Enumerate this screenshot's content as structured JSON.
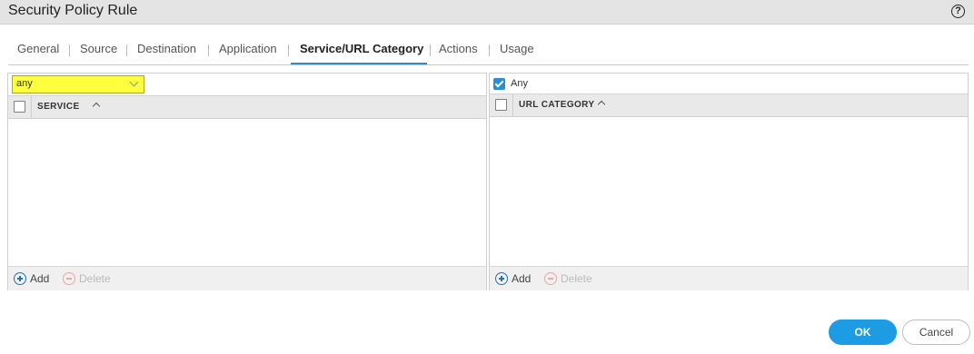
{
  "dialog": {
    "title": "Security Policy Rule",
    "help_icon": "?"
  },
  "tabs": [
    {
      "label": "General"
    },
    {
      "label": "Source"
    },
    {
      "label": "Destination"
    },
    {
      "label": "Application"
    },
    {
      "label": "Service/URL Category",
      "active": true
    },
    {
      "label": "Actions"
    },
    {
      "label": "Usage"
    }
  ],
  "service_panel": {
    "dropdown_value": "any",
    "column_header": "SERVICE",
    "add_label": "Add",
    "delete_label": "Delete"
  },
  "url_panel": {
    "any_label": "Any",
    "any_checked": true,
    "column_header": "URL CATEGORY",
    "add_label": "Add",
    "delete_label": "Delete"
  },
  "buttons": {
    "ok": "OK",
    "cancel": "Cancel"
  },
  "colors": {
    "accent": "#1e9ce3",
    "highlight": "#ffff3c"
  }
}
